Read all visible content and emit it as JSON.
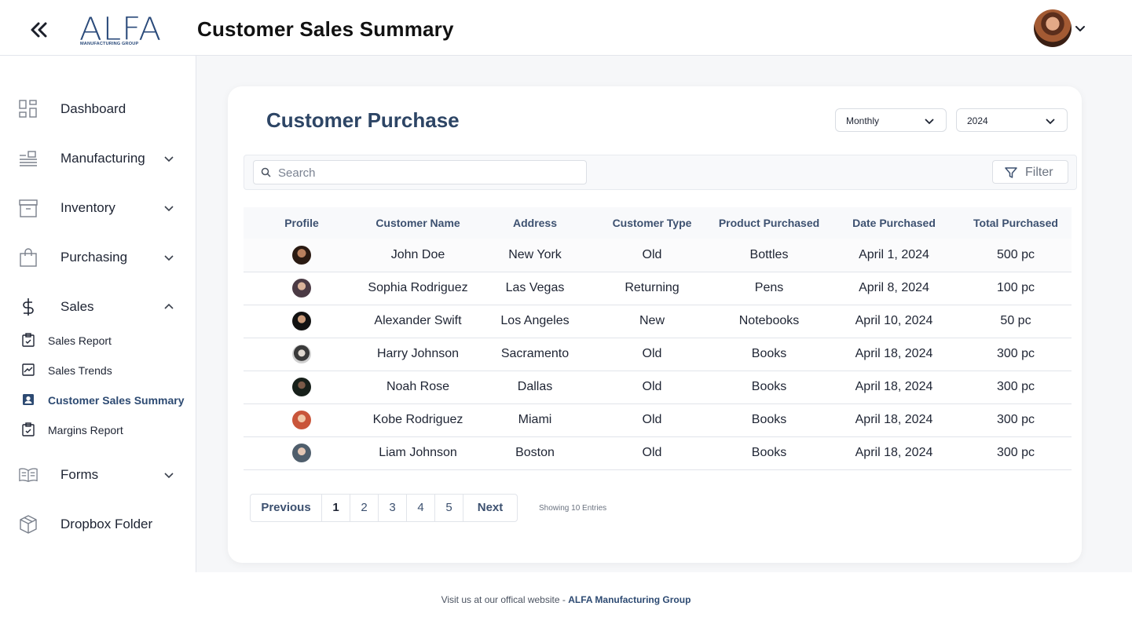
{
  "header": {
    "logo_text": "ALFA",
    "logo_subtext": "MANUFACTURING GROUP",
    "title": "Customer Sales Summary"
  },
  "sidebar": {
    "items": [
      {
        "label": "Dashboard",
        "icon": "dashboard-icon"
      },
      {
        "label": "Manufacturing",
        "icon": "manufacturing-icon",
        "expandable": true
      },
      {
        "label": "Inventory",
        "icon": "inventory-icon",
        "expandable": true
      },
      {
        "label": "Purchasing",
        "icon": "shopping-bag-icon",
        "expandable": true
      },
      {
        "label": "Sales",
        "icon": "dollar-icon",
        "expandable": true,
        "expanded": true
      },
      {
        "label": "Forms",
        "icon": "book-icon",
        "expandable": true
      },
      {
        "label": "Dropbox Folder",
        "icon": "box-icon"
      }
    ],
    "sales_sub": [
      {
        "label": "Sales Report",
        "icon": "clipboard-icon"
      },
      {
        "label": "Sales Trends",
        "icon": "trend-chart-icon"
      },
      {
        "label": "Customer Sales Summary",
        "icon": "contact-card-icon",
        "active": true
      },
      {
        "label": "Margins Report",
        "icon": "clipboard-icon"
      }
    ]
  },
  "card": {
    "title": "Customer Purchase",
    "period": "Monthly",
    "year": "2024",
    "search_placeholder": "Search",
    "filter_label": "Filter"
  },
  "table": {
    "headers": [
      "Profile",
      "Customer Name",
      "Address",
      "Customer Type",
      "Product Purchased",
      "Date Purchased",
      "Total Purchased"
    ],
    "rows": [
      {
        "name": "John Doe",
        "address": "New York",
        "type": "Old",
        "product": "Bottles",
        "date": "April 1, 2024",
        "total": "500 pc"
      },
      {
        "name": "Sophia Rodriguez",
        "address": "Las Vegas",
        "type": "Returning",
        "product": "Pens",
        "date": "April 8, 2024",
        "total": "100 pc"
      },
      {
        "name": "Alexander Swift",
        "address": "Los Angeles",
        "type": "New",
        "product": "Notebooks",
        "date": "April 10, 2024",
        "total": "50 pc"
      },
      {
        "name": "Harry Johnson",
        "address": "Sacramento",
        "type": "Old",
        "product": "Books",
        "date": "April 18, 2024",
        "total": "300 pc"
      },
      {
        "name": "Noah Rose",
        "address": "Dallas",
        "type": "Old",
        "product": "Books",
        "date": "April 18, 2024",
        "total": "300 pc"
      },
      {
        "name": "Kobe Rodriguez",
        "address": "Miami",
        "type": "Old",
        "product": "Books",
        "date": "April 18, 2024",
        "total": "300 pc"
      },
      {
        "name": "Liam Johnson",
        "address": "Boston",
        "type": "Old",
        "product": "Books",
        "date": "April 18, 2024",
        "total": "300 pc"
      }
    ]
  },
  "pagination": {
    "previous": "Previous",
    "pages": [
      "1",
      "2",
      "3",
      "4",
      "5"
    ],
    "current": "1",
    "next": "Next",
    "entries": "Showing 10 Entries"
  },
  "footer": {
    "text": "Visit us at our offical website - ",
    "link": "ALFA Manufacturing Group"
  },
  "colors": {
    "accent": "#2d4a72",
    "card_title": "#2d4565",
    "background": "#f6f7f9"
  }
}
